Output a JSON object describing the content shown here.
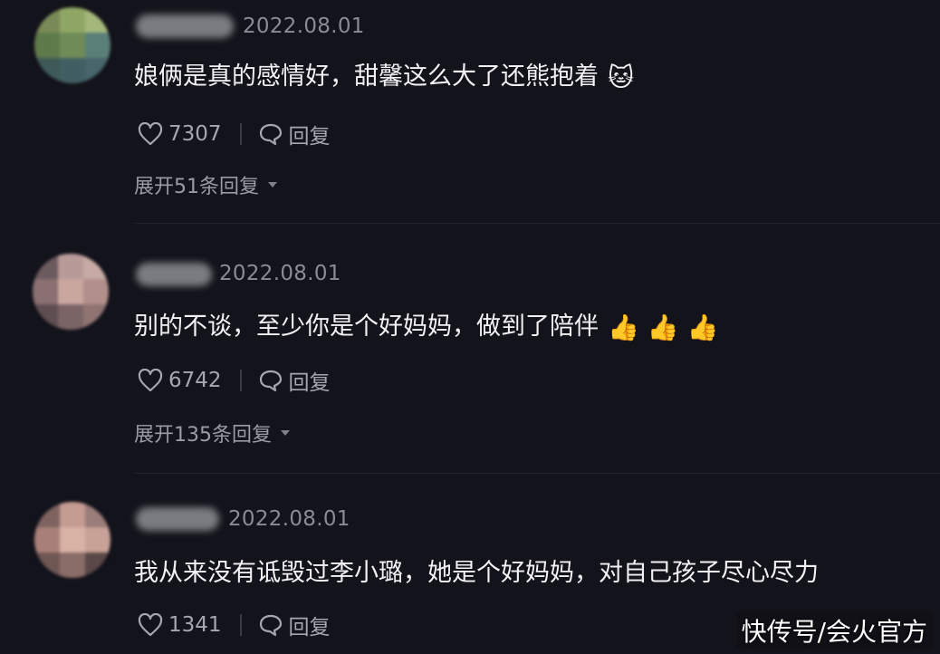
{
  "comments": [
    {
      "date": "2022.08.01",
      "text": "娘俩是真的感情好，甜馨这么大了还熊抱着",
      "emoji": "🐱",
      "likes": "7307",
      "reply_label": "回复",
      "expand_label": "展开51条回复"
    },
    {
      "date": "2022.08.01",
      "text": "别的不谈，至少你是个好妈妈，做到了陪伴",
      "emoji": "👍 👍 👍",
      "likes": "6742",
      "reply_label": "回复",
      "expand_label": "展开135条回复"
    },
    {
      "date": "2022.08.01",
      "text": "我从来没有诋毁过李小璐，她是个好妈妈，对自己孩子尽心尽力",
      "emoji": "",
      "likes": "1341",
      "reply_label": "回复",
      "expand_label": ""
    }
  ],
  "watermark": "快传号/会火官方",
  "colors": {
    "background": "#13131b",
    "text": "#f2f2f4",
    "meta": "#8a8b93"
  },
  "icons": {
    "like": "heart-icon",
    "reply": "speech-bubble-icon",
    "expand": "caret-down-icon"
  }
}
